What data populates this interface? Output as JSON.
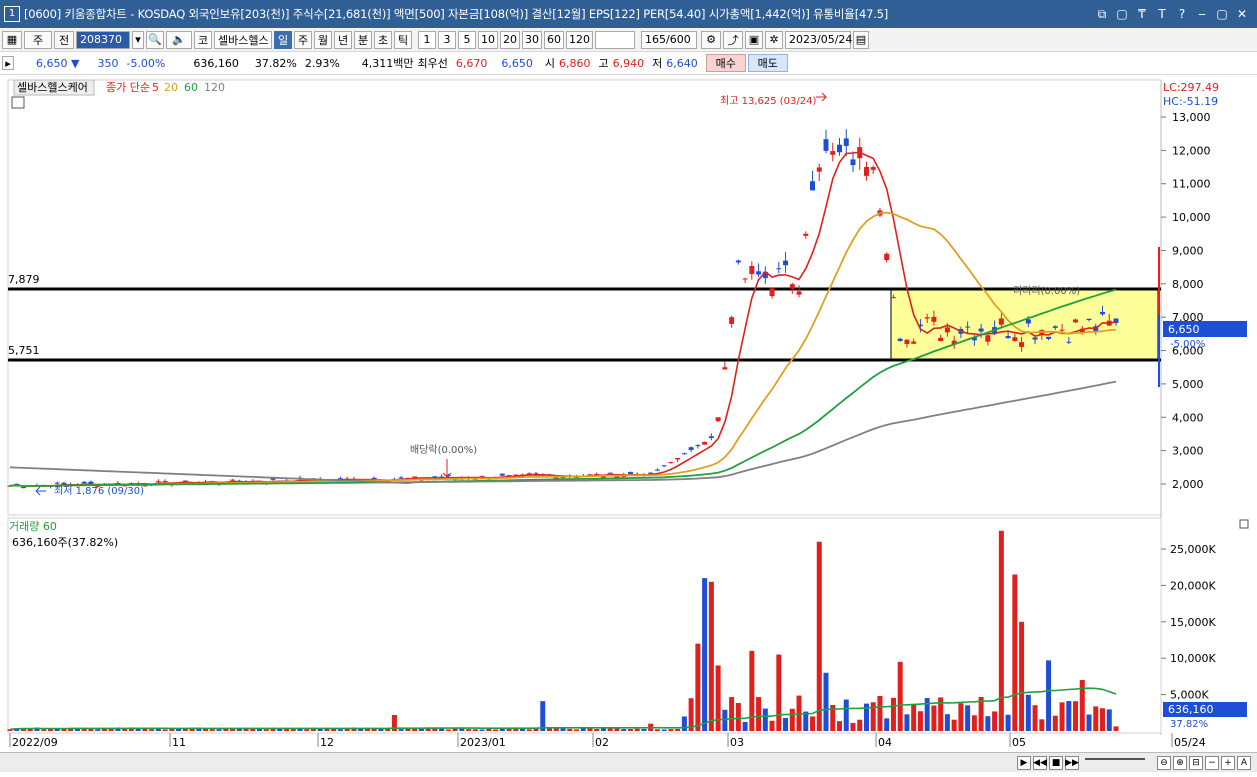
{
  "window": {
    "num": "1",
    "title": "[0600] 키움종합차트 - KOSDAQ 외국인보유[203(천)] 주식수[21,681(천)] 액면[500] 자본금[108(억)] 결산[12월] EPS[122] PER[54.40] 시가총액[1,442(억)] 유통비율[47.5]",
    "controls": [
      "⧉",
      "▢",
      "₸",
      "T",
      "?",
      "‒",
      "▢",
      "✕"
    ]
  },
  "toolbar1": {
    "type_btn": "주",
    "prev_btn": "전",
    "code": "208370",
    "search_icon": "🔍",
    "speaker_icon": "🔈",
    "market_btn": "코",
    "stock_name": "셀바스헬스",
    "periods": [
      "일",
      "주",
      "월",
      "년",
      "분",
      "초",
      "틱"
    ],
    "period_selected": "일",
    "intervals": [
      "1",
      "3",
      "5",
      "10",
      "20",
      "30",
      "60",
      "120"
    ],
    "count": "165",
    "count_total": "/600",
    "date": "2023/05/24"
  },
  "toolbar2": {
    "price": "6,650",
    "change": "350",
    "change_pct": "-5.00%",
    "volume": "636,160",
    "vol_ratio": "37.82%",
    "turnover": "2.93%",
    "amount": "4,311백만",
    "best_label": "최우선",
    "ask": "6,670",
    "bid": "6,650",
    "open_label": "시",
    "open": "6,860",
    "high_label": "고",
    "high": "6,940",
    "low_label": "저",
    "low": "6,640",
    "buy": "매수",
    "sell": "매도"
  },
  "price_panel": {
    "stock_tab": "셀바스헬스케어",
    "ma_legend": {
      "label": "종가 단순",
      "periods": [
        "5",
        "20",
        "60",
        "120"
      ],
      "colors": [
        "#e0201c",
        "#e0a020",
        "#20a040",
        "#808080"
      ]
    },
    "lc": "LC:297.49",
    "hc": "HC:-51.19",
    "high_note": "최고 13,625 (03/24)",
    "low_note": "최저 1,876 (09/30)",
    "div_note": "배당락(0.00%)",
    "box_note": "리리리(0.00%)",
    "hline_top": "7,879",
    "hline_bottom": "5,751",
    "current_price_label": "6,650",
    "current_pct_label": "-5.00%",
    "yticks": [
      "13,000",
      "12,000",
      "11,000",
      "10,000",
      "9,000",
      "8,000",
      "7,000",
      "6,000",
      "5,000",
      "4,000",
      "3,000",
      "2,000"
    ]
  },
  "volume_panel": {
    "label": "거래량",
    "ma": "60",
    "value": "636,160주(37.82%)",
    "yticks": [
      "25,000K",
      "20,000K",
      "15,000K",
      "10,000K",
      "5,000K"
    ],
    "current_label": "636,160",
    "current_pct": "37.82%"
  },
  "xaxis": [
    "2022/09",
    "11",
    "12",
    "2023/01",
    "02",
    "03",
    "04",
    "05",
    "05/24"
  ],
  "colors": {
    "up": "#e0201c",
    "down": "#1e4dd6",
    "box": "#ffff99",
    "bg": "#ffffff"
  }
}
